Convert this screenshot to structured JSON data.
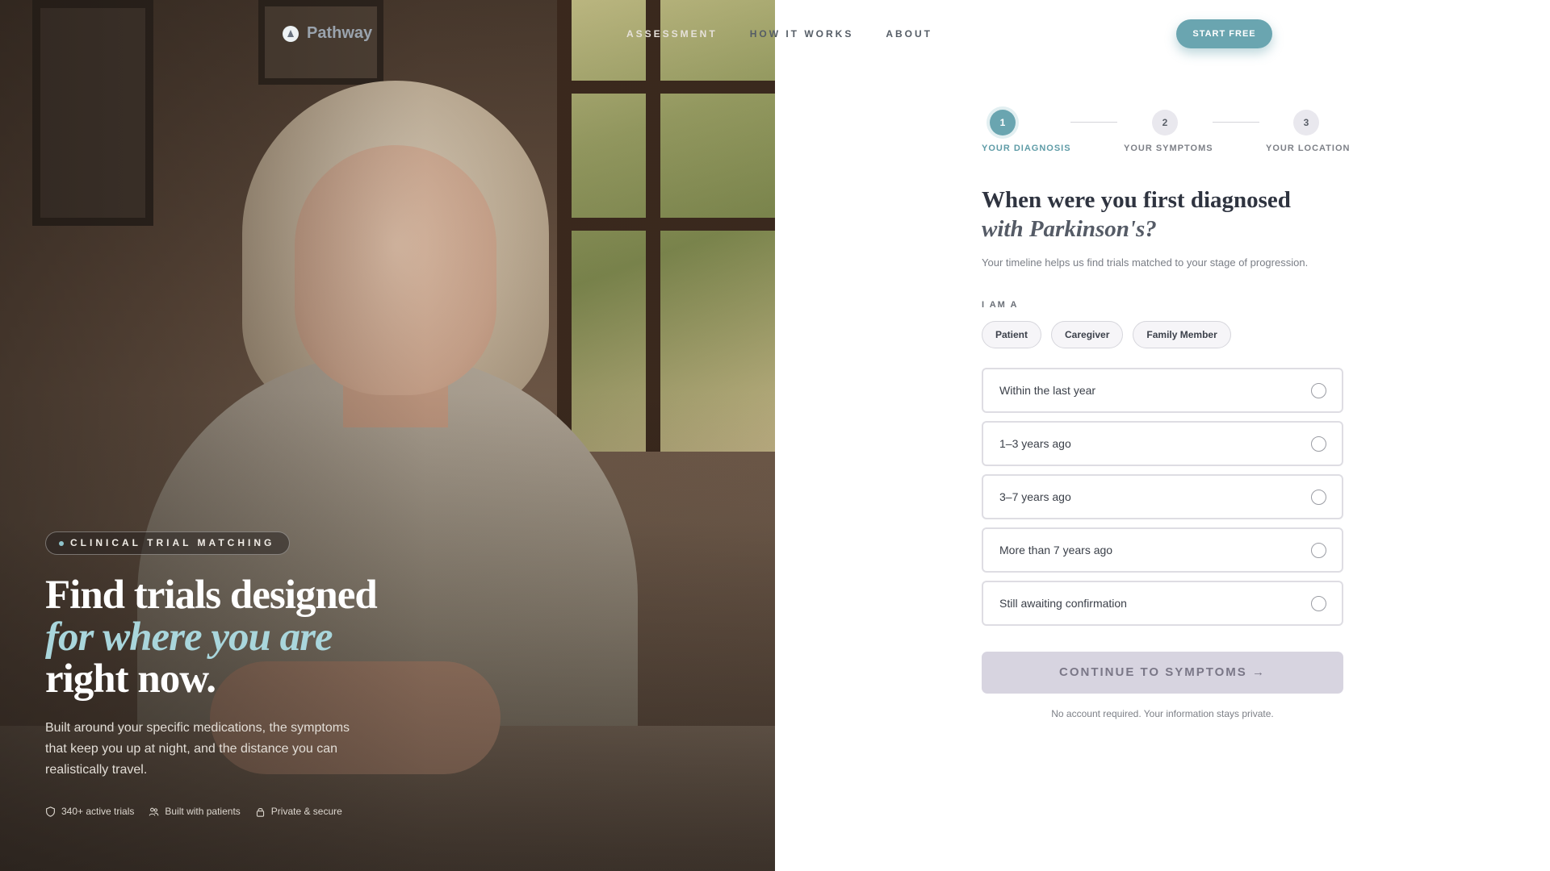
{
  "brand": {
    "name": "Pathway"
  },
  "nav": {
    "items": [
      "ASSESSMENT",
      "HOW IT WORKS",
      "ABOUT"
    ],
    "cta": "START FREE"
  },
  "hero": {
    "badge": "CLINICAL TRIAL MATCHING",
    "title_line1": "Find trials designed",
    "title_line2": "for where you are",
    "title_line3": "right now.",
    "subtitle": "Built around your specific medications, the symptoms that keep you up at night, and the distance you can realistically travel.",
    "trust": [
      {
        "icon": "shield-icon",
        "label": "340+ active trials"
      },
      {
        "icon": "people-icon",
        "label": "Built with patients"
      },
      {
        "icon": "lock-icon",
        "label": "Private & secure"
      }
    ]
  },
  "stepper": {
    "steps": [
      {
        "number": "1",
        "label": "YOUR DIAGNOSIS",
        "state": "active"
      },
      {
        "number": "2",
        "label": "YOUR SYMPTOMS",
        "state": "todo"
      },
      {
        "number": "3",
        "label": "YOUR LOCATION",
        "state": "todo"
      }
    ]
  },
  "form": {
    "question_line1": "When were you first diagnosed",
    "question_line2": "with Parkinson's?",
    "help": "Your timeline helps us find trials matched to your stage of progression.",
    "role_label": "I AM A",
    "roles": [
      "Patient",
      "Caregiver",
      "Family Member"
    ],
    "options": [
      "Within the last year",
      "1–3 years ago",
      "3–7 years ago",
      "More than 7 years ago",
      "Still awaiting confirmation"
    ],
    "continue_label": "CONTINUE TO SYMPTOMS →",
    "privacy": "No account required. Your information stays private."
  },
  "colors": {
    "accent": "#6aa5b0",
    "disabled_button": "#d7d4e0",
    "hero_italic": "#a9d6dc"
  }
}
